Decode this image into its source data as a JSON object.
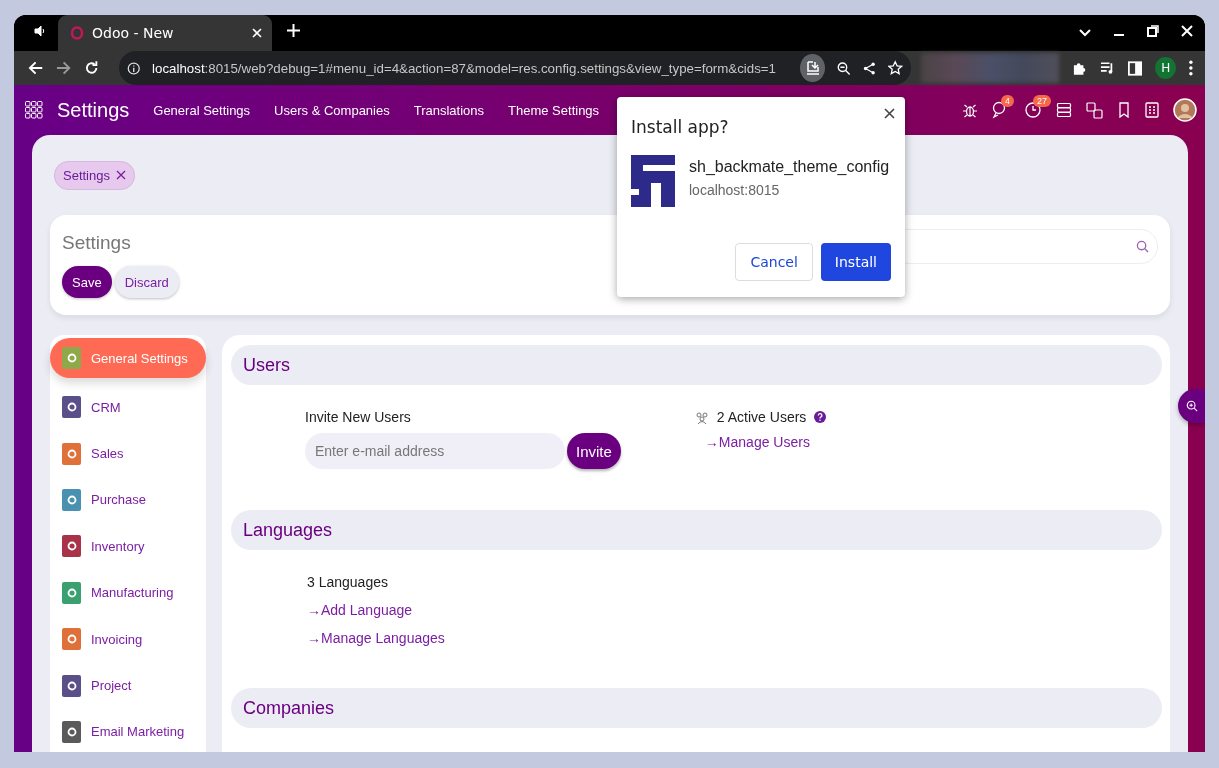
{
  "browser": {
    "tabs": [
      {
        "title": "Odoo - New",
        "selected": true
      }
    ],
    "url": {
      "host": "localhost",
      "rest": ":8015/web?debug=1#menu_id=4&action=87&model=res.config.settings&view_type=form&cids=1"
    },
    "profile_initial": "H"
  },
  "navbar": {
    "app_name": "Settings",
    "menu": [
      "General Settings",
      "Users & Companies",
      "Translations",
      "Theme Settings"
    ],
    "badges": [
      {
        "kind": "chat",
        "count": "4"
      },
      {
        "kind": "activity",
        "count": "27"
      }
    ]
  },
  "breadcrumb_chip": {
    "label": "Settings"
  },
  "control_panel": {
    "title": "Settings",
    "buttons": [
      {
        "label": "Save",
        "kind": "primary"
      },
      {
        "label": "Discard",
        "kind": "secondary"
      }
    ]
  },
  "sidebar": {
    "items": [
      {
        "label": "General Settings",
        "selected": true,
        "color": "#8fa84a"
      },
      {
        "label": "CRM",
        "selected": false,
        "color": "#5b4f8a"
      },
      {
        "label": "Sales",
        "selected": false,
        "color": "#e0703a"
      },
      {
        "label": "Purchase",
        "selected": false,
        "color": "#4a90b0"
      },
      {
        "label": "Inventory",
        "selected": false,
        "color": "#a8324a"
      },
      {
        "label": "Manufacturing",
        "selected": false,
        "color": "#3aa070"
      },
      {
        "label": "Invoicing",
        "selected": false,
        "color": "#e0703a"
      },
      {
        "label": "Project",
        "selected": false,
        "color": "#5b4f8a"
      },
      {
        "label": "Email Marketing",
        "selected": false,
        "color": "#5a5a5a"
      }
    ]
  },
  "sections": [
    {
      "title": "Users",
      "kind": "users",
      "invite_label": "Invite New Users",
      "invite_placeholder": "Enter e-mail address",
      "invite_button": "Invite",
      "active_users": "2 Active Users",
      "links": [
        "→Manage Users"
      ]
    },
    {
      "title": "Languages",
      "kind": "languages",
      "count_text": "3 Languages",
      "links": [
        "→Add Language",
        "→Manage Languages"
      ]
    },
    {
      "title": "Companies",
      "kind": "header"
    }
  ],
  "install_popup": {
    "title": "Install app?",
    "app_name": "sh_backmate_theme_config",
    "origin": "localhost:8015",
    "cancel": "Cancel",
    "install": "Install"
  }
}
